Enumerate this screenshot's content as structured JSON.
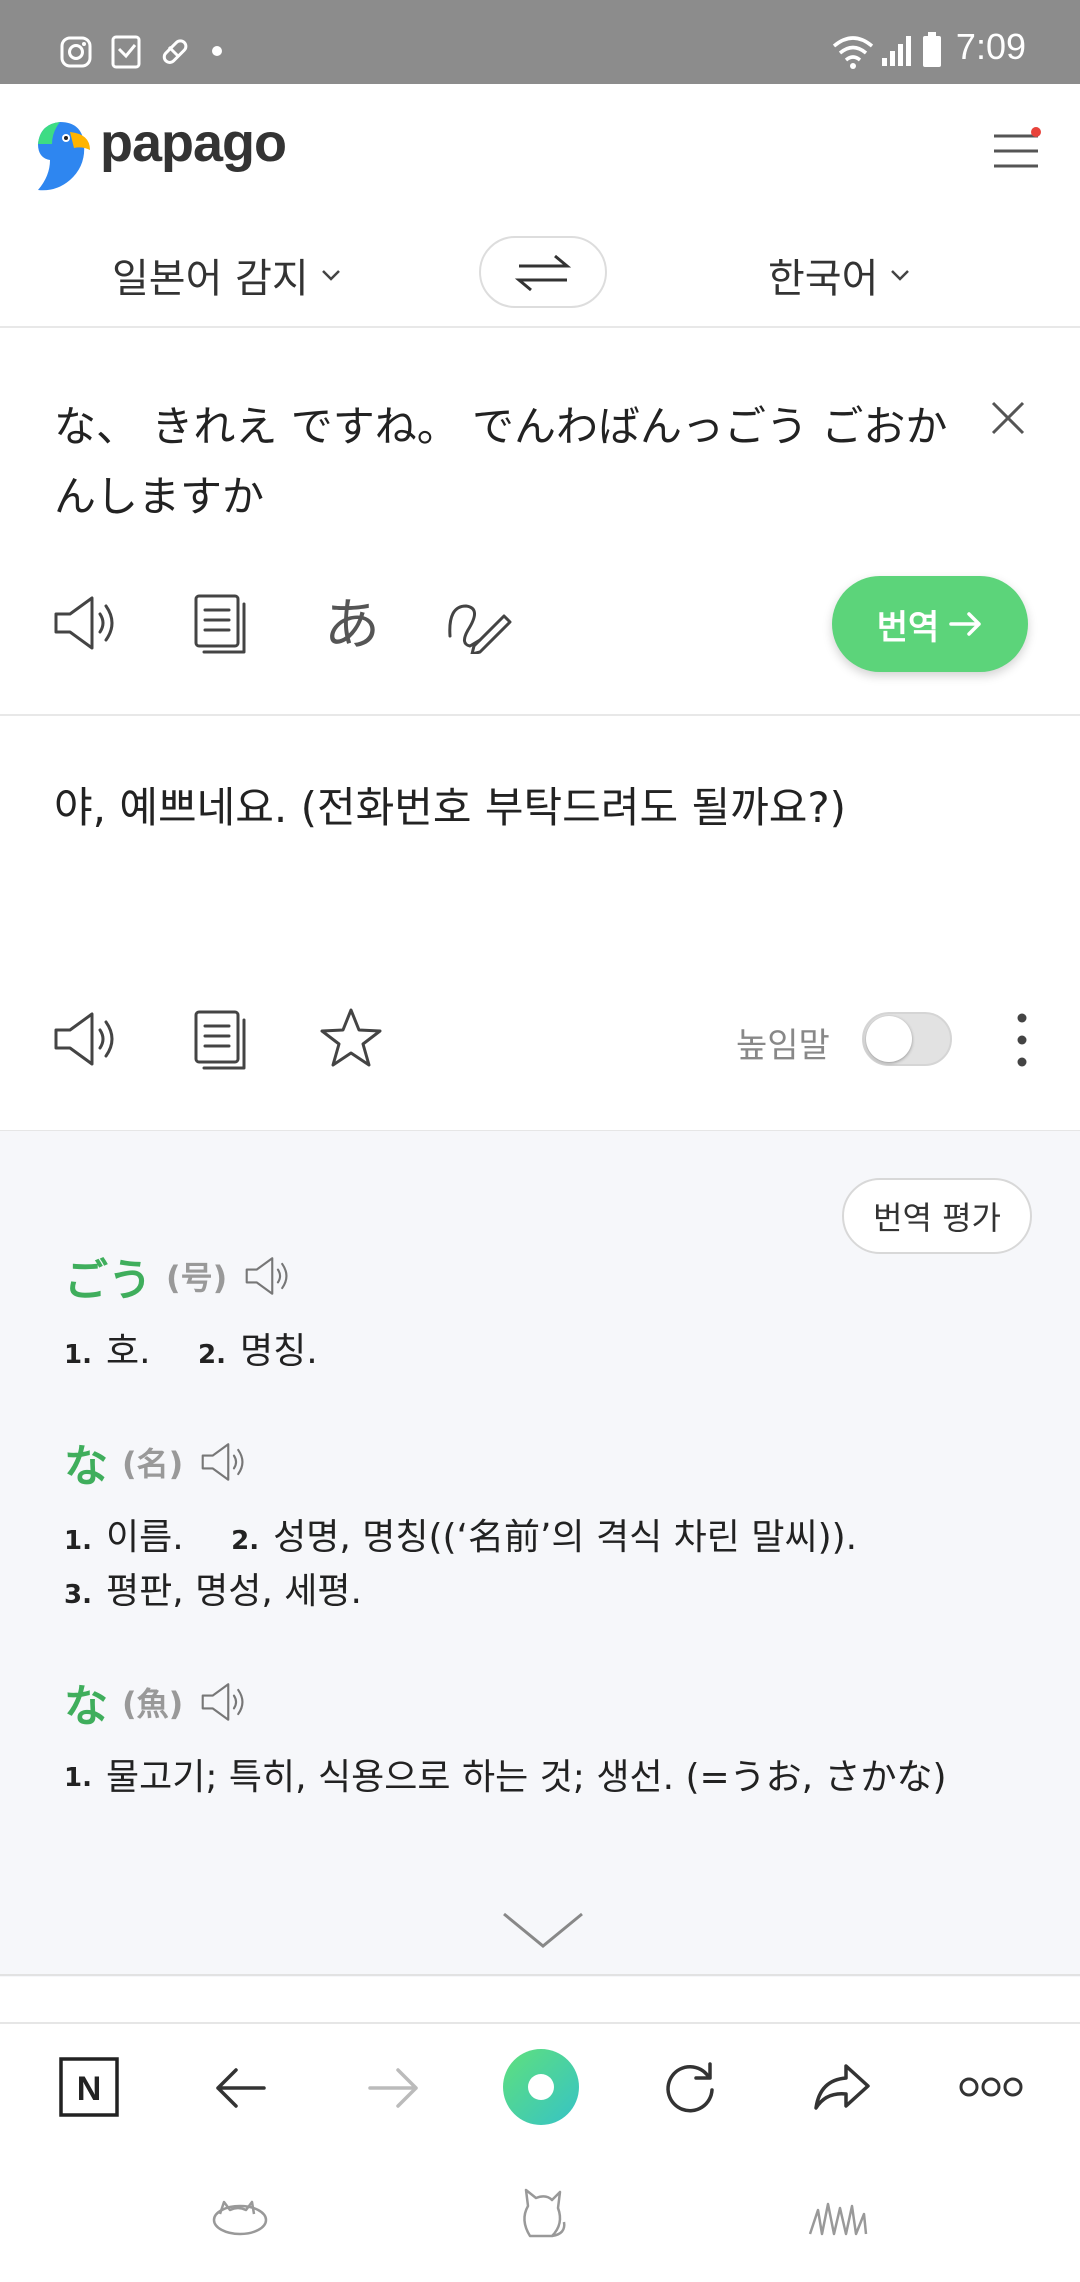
{
  "status_bar": {
    "time": "7:09",
    "left_icons": [
      "instagram-icon",
      "app-icon",
      "pill-icon",
      "dot-icon"
    ],
    "right_icons": [
      "wifi-icon",
      "signal-icon",
      "battery-icon"
    ]
  },
  "header": {
    "logo_text": "papago",
    "menu_icon": "hamburger-menu-icon",
    "notification_dot_color": "#e8433b"
  },
  "language_bar": {
    "source_language": "일본어 감지",
    "target_language": "한국어",
    "swap_icon": "swap-arrows-icon"
  },
  "source": {
    "text": "な、 きれえ ですね。 でんわばんっごう ごおかんしますか",
    "tools": [
      "speaker-icon",
      "copy-icon",
      "hiragana-icon",
      "handwriting-icon"
    ],
    "translate_button": "번역",
    "clear_icon": "close-icon"
  },
  "result": {
    "text": "야, 예쁘네요. (전화번호 부탁드려도 될까요?)",
    "tools": [
      "speaker-icon",
      "copy-icon",
      "star-icon"
    ],
    "honorific_label": "높임말",
    "honorific_on": false,
    "more_icon": "kebab-menu-icon"
  },
  "dictionary": {
    "rate_button": "번역 평가",
    "entries": [
      {
        "word": "ごう",
        "reading": "(号)",
        "definitions": [
          {
            "num": "1.",
            "text": "호."
          },
          {
            "num": "2.",
            "text": "명칭."
          }
        ]
      },
      {
        "word": "な",
        "reading": "(名)",
        "definitions": [
          {
            "num": "1.",
            "text": "이름."
          },
          {
            "num": "2.",
            "text": "성명, 명칭((‘名前’의 격식 차린 말씨))."
          },
          {
            "num": "3.",
            "text": "평판, 명성, 세평."
          }
        ]
      },
      {
        "word": "な",
        "reading": "(魚)",
        "definitions": [
          {
            "num": "1.",
            "text": "물고기; 특히, 식용으로 하는 것; 생선. (=うお, さかな)"
          }
        ]
      }
    ],
    "expand_icon": "chevron-down-icon"
  },
  "browser_bar": {
    "buttons": [
      "naver-home-icon",
      "back-arrow-icon",
      "forward-arrow-icon",
      "green-dot-icon",
      "refresh-icon",
      "share-icon",
      "more-dots-icon"
    ],
    "pets": [
      "cat-sleeping-icon",
      "cat-sitting-icon",
      "cat-in-grass-icon"
    ]
  },
  "colors": {
    "accent_green": "#5cd47a",
    "word_green": "#3fae5c",
    "status_bar_gray": "#8c8c8c"
  }
}
